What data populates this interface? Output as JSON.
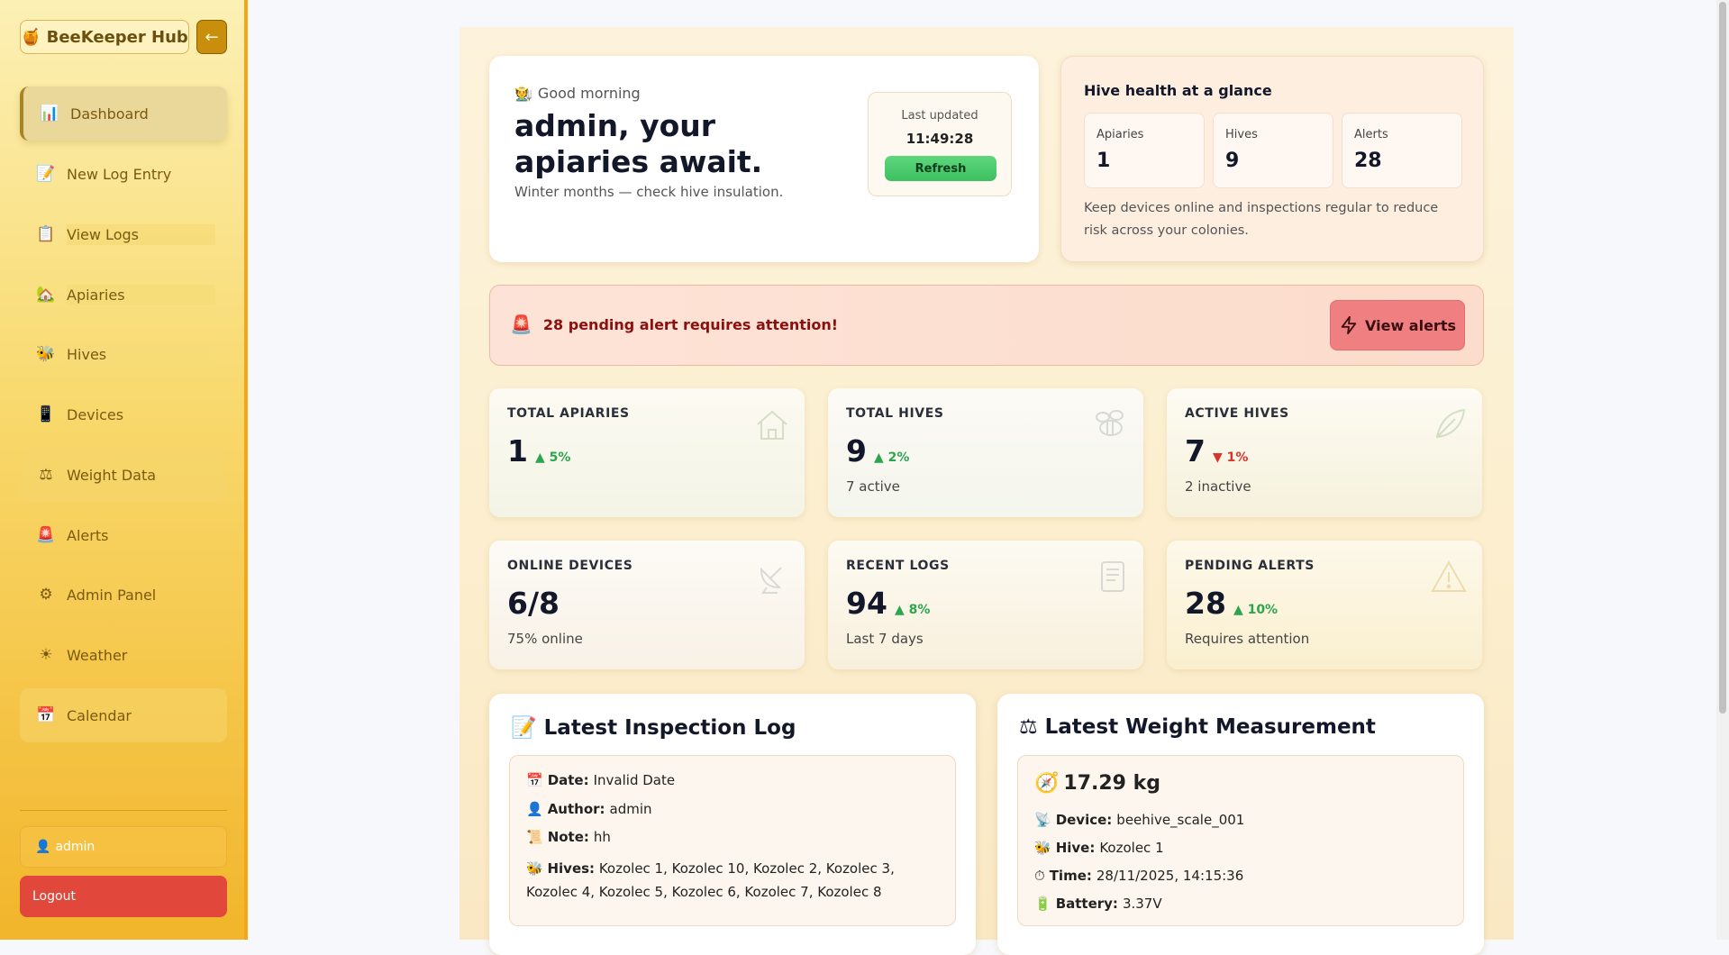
{
  "sidebar": {
    "brand": "BeeKeeper Hub",
    "collapse": "←",
    "items": [
      {
        "label": "Dashboard",
        "icon": "📊"
      },
      {
        "label": "New Log Entry",
        "icon": "📝"
      },
      {
        "label": "View Logs",
        "icon": "📋"
      },
      {
        "label": "Apiaries",
        "icon": "🏡"
      },
      {
        "label": "Hives",
        "icon": "🐝"
      },
      {
        "label": "Devices",
        "icon": "📱"
      },
      {
        "label": "Weight Data",
        "icon": "⚖"
      },
      {
        "label": "Alerts",
        "icon": "🚨"
      },
      {
        "label": "Admin Panel",
        "icon": "⚙"
      },
      {
        "label": "Weather",
        "icon": "☀"
      },
      {
        "label": "Calendar",
        "icon": "📅"
      }
    ],
    "user": "admin",
    "logout": "Logout"
  },
  "greeting": {
    "subtitle": "Good morning",
    "title": "admin, your apiaries await.",
    "note": "Winter months — check hive insulation.",
    "updated_label": "Last updated",
    "updated_time": "11:49:28",
    "refresh": "Refresh"
  },
  "health": {
    "title": "Hive health at a glance",
    "stats": [
      {
        "label": "Apiaries",
        "value": "1"
      },
      {
        "label": "Hives",
        "value": "9"
      },
      {
        "label": "Alerts",
        "value": "28"
      }
    ],
    "text": "Keep devices online and inspections regular to reduce risk across your colonies."
  },
  "alert_banner": {
    "text": "28 pending alert requires attention!",
    "button": "View alerts"
  },
  "stats": [
    {
      "label": "TOTAL APIARIES",
      "value": "1",
      "trend": "▲ 5%",
      "dir": "up",
      "sub": ""
    },
    {
      "label": "TOTAL HIVES",
      "value": "9",
      "trend": "▲ 2%",
      "dir": "up",
      "sub": "7 active"
    },
    {
      "label": "ACTIVE HIVES",
      "value": "7",
      "trend": "▼ 1%",
      "dir": "down",
      "sub": "2 inactive"
    },
    {
      "label": "ONLINE DEVICES",
      "value": "6/8",
      "trend": "",
      "dir": "up",
      "sub": "75% online"
    },
    {
      "label": "RECENT LOGS",
      "value": "94",
      "trend": "▲ 8%",
      "dir": "up",
      "sub": "Last 7 days"
    },
    {
      "label": "PENDING ALERTS",
      "value": "28",
      "trend": "▲ 10%",
      "dir": "up",
      "sub": "Requires attention"
    }
  ],
  "inspection": {
    "title": "Latest Inspection Log",
    "date_label": "Date:",
    "date": "Invalid Date",
    "author_label": "Author:",
    "author": "admin",
    "note_label": "Note:",
    "note": "hh",
    "hives_label": "Hives:",
    "hives": "Kozolec 1, Kozolec 10, Kozolec 2, Kozolec 3, Kozolec 4, Kozolec 5, Kozolec 6, Kozolec 7, Kozolec 8"
  },
  "weight": {
    "title": "Latest Weight Measurement",
    "value": "17.29 kg",
    "device_label": "Device:",
    "device": "beehive_scale_001",
    "hive_label": "Hive:",
    "hive": "Kozolec 1",
    "time_label": "Time:",
    "time": "28/11/2025, 14:15:36",
    "battery_label": "Battery:",
    "battery": "3.37V"
  }
}
